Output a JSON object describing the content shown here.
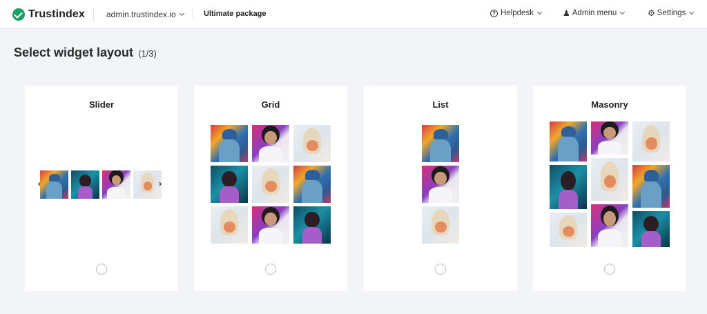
{
  "header": {
    "brand": "Trustindex",
    "domain": "admin.trustindex.io",
    "package": "Ultimate package",
    "nav": [
      {
        "label": "Helpdesk",
        "icon": "help-circle-icon"
      },
      {
        "label": "Admin menu",
        "icon": "admin-user-icon"
      },
      {
        "label": "Settings",
        "icon": "gear-icon"
      }
    ]
  },
  "page": {
    "title": "Select widget layout",
    "step": "(1/3)"
  },
  "layouts": [
    {
      "name": "Slider",
      "selected": false
    },
    {
      "name": "Grid",
      "selected": false
    },
    {
      "name": "List",
      "selected": false
    },
    {
      "name": "Masonry",
      "selected": false
    }
  ],
  "colors": {
    "brand_green": "#1aa064",
    "background": "#f3f4f7",
    "card": "#ffffff"
  }
}
